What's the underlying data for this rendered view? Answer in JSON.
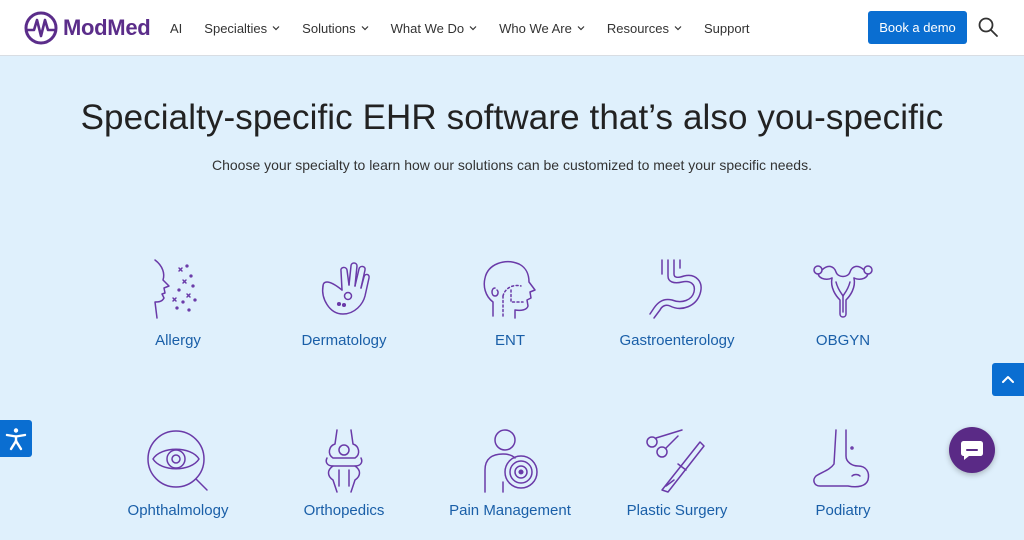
{
  "brand": {
    "name": "ModMed",
    "color": "#5b2d8a",
    "icon": "heartbeat-m-logo-icon"
  },
  "nav": {
    "items": [
      {
        "label": "AI",
        "dropdown": false
      },
      {
        "label": "Specialties",
        "dropdown": true
      },
      {
        "label": "Solutions",
        "dropdown": true
      },
      {
        "label": "What We Do",
        "dropdown": true
      },
      {
        "label": "Who We Are",
        "dropdown": true
      },
      {
        "label": "Resources",
        "dropdown": true
      },
      {
        "label": "Support",
        "dropdown": false
      }
    ],
    "cta_label": "Book a demo",
    "search_icon": "search-icon"
  },
  "hero": {
    "title": "Specialty-specific EHR software that’s also you-specific",
    "subtitle": "Choose your specialty to learn how our solutions can be customized to meet your specific needs."
  },
  "specialties": [
    {
      "label": "Allergy",
      "icon": "allergy-icon"
    },
    {
      "label": "Dermatology",
      "icon": "dermatology-icon"
    },
    {
      "label": "ENT",
      "icon": "ent-icon"
    },
    {
      "label": "Gastroenterology",
      "icon": "gastroenterology-icon"
    },
    {
      "label": "OBGYN",
      "icon": "obgyn-icon"
    },
    {
      "label": "Ophthalmology",
      "icon": "ophthalmology-icon"
    },
    {
      "label": "Orthopedics",
      "icon": "orthopedics-icon"
    },
    {
      "label": "Pain Management",
      "icon": "pain-management-icon"
    },
    {
      "label": "Plastic Surgery",
      "icon": "plastic-surgery-icon"
    },
    {
      "label": "Podiatry",
      "icon": "podiatry-icon"
    }
  ],
  "colors": {
    "accent_blue": "#0a6ed1",
    "icon_purple": "#6a3aa8",
    "label_blue": "#1a5fa8",
    "page_bg": "#dff0fc",
    "chat_purple": "#5a2a86"
  },
  "floating": {
    "scroll_top_icon": "chevron-up-icon",
    "accessibility_icon": "accessibility-icon",
    "chat_icon": "chat-bubble-icon"
  }
}
